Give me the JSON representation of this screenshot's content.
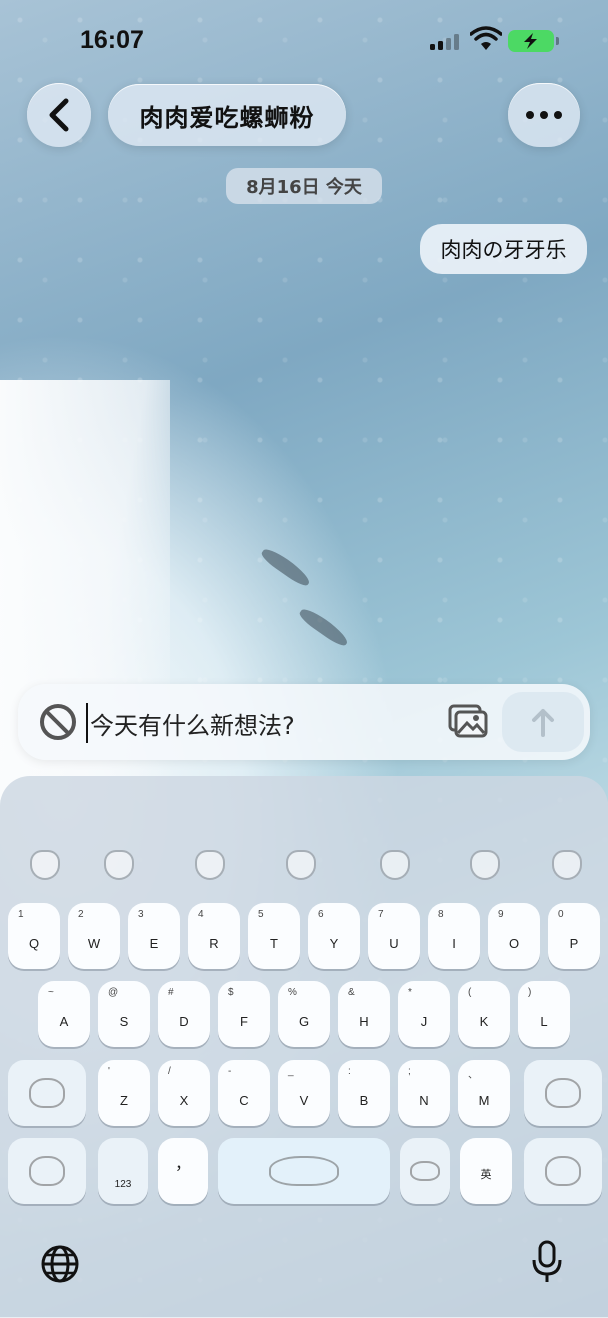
{
  "status_bar": {
    "time": "16:07"
  },
  "header": {
    "title": "肉肉爱吃螺蛳粉"
  },
  "chat": {
    "date_label": "8月16日 今天",
    "messages": [
      {
        "text": "肉肉の牙牙乐",
        "from": "self"
      }
    ]
  },
  "input": {
    "placeholder": "今天有什么新想法?"
  },
  "keyboard": {
    "row1": [
      {
        "letter": "Q",
        "num": "1"
      },
      {
        "letter": "W",
        "num": "2"
      },
      {
        "letter": "E",
        "num": "3"
      },
      {
        "letter": "R",
        "num": "4"
      },
      {
        "letter": "T",
        "num": "5"
      },
      {
        "letter": "Y",
        "num": "6"
      },
      {
        "letter": "U",
        "num": "7"
      },
      {
        "letter": "I",
        "num": "8"
      },
      {
        "letter": "O",
        "num": "9"
      },
      {
        "letter": "P",
        "num": "0"
      }
    ],
    "row2": [
      {
        "letter": "A",
        "num": "~"
      },
      {
        "letter": "S",
        "num": "@"
      },
      {
        "letter": "D",
        "num": "#"
      },
      {
        "letter": "F",
        "num": "$"
      },
      {
        "letter": "G",
        "num": "%"
      },
      {
        "letter": "H",
        "num": "&"
      },
      {
        "letter": "J",
        "num": "*"
      },
      {
        "letter": "K",
        "num": "("
      },
      {
        "letter": "L",
        "num": ")"
      }
    ],
    "row3": [
      {
        "letter": "Z",
        "num": "'"
      },
      {
        "letter": "X",
        "num": "/"
      },
      {
        "letter": "C",
        "num": "-"
      },
      {
        "letter": "V",
        "num": "_"
      },
      {
        "letter": "B",
        "num": ":"
      },
      {
        "letter": "N",
        "num": ";"
      },
      {
        "letter": "M",
        "num": "、"
      }
    ],
    "numbers_label": "123",
    "comma_label": "，",
    "lang_label": "英"
  },
  "colors": {
    "accent": "#4cd964",
    "key_bg": "#fbfdff"
  }
}
